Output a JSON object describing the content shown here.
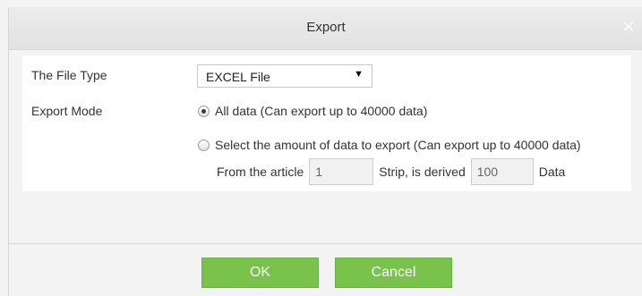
{
  "dialog": {
    "title": "Export",
    "close_glyph": "×"
  },
  "form": {
    "file_type_label": "The File Type",
    "file_type_value": "EXCEL File",
    "file_type_arrow": "▼",
    "export_mode_label": "Export Mode",
    "option_all": "All data (Can export up to 40000 data)",
    "option_select": "Select the amount of data to export (Can export up to 40000 data)",
    "option_all_checked": true,
    "from_label": "From the article",
    "from_value": "1",
    "strip_label": "Strip, is derived",
    "count_value": "100",
    "data_label": "Data"
  },
  "buttons": {
    "ok": "OK",
    "cancel": "Cancel"
  },
  "colors": {
    "button_green": "#79c24b",
    "title_bar": "#e6e6e6"
  }
}
